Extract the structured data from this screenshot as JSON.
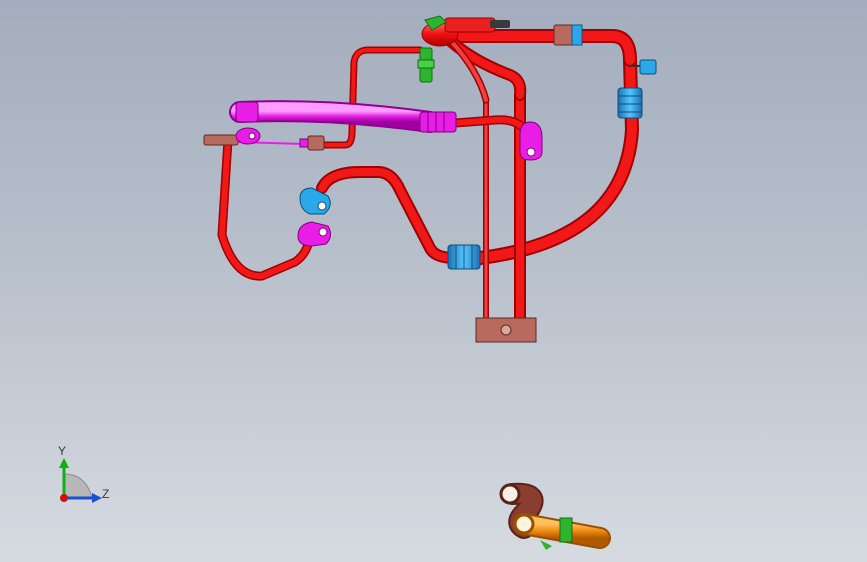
{
  "window": {
    "title": ""
  },
  "colors": {
    "background_top": "#a3adbd",
    "background_bottom": "#d6dbe1",
    "pipe_red": "#f21818",
    "pipe_red_light": "#ff6b6b",
    "hose_magenta": "#e81ee6",
    "clamp_cyan": "#2aa8e8",
    "connector_brown": "#b86a5f",
    "valve_green": "#2db52d",
    "axis_y": "#10b010",
    "axis_z": "#1a4fd8",
    "axis_x": "#d01010",
    "part_orange": "#f09020",
    "part_brown": "#7a3a2e"
  },
  "triad": {
    "y_label": "Y",
    "z_label": "Z"
  },
  "parts": [
    {
      "name": "main-refrigerant-pipe",
      "color": "pipe_red"
    },
    {
      "name": "suction-hose",
      "color": "hose_magenta"
    },
    {
      "name": "mounting-block",
      "color": "connector_brown"
    },
    {
      "name": "pressure-valve",
      "color": "valve_green"
    },
    {
      "name": "secondary-assembly-preview",
      "color": "part_orange"
    }
  ]
}
